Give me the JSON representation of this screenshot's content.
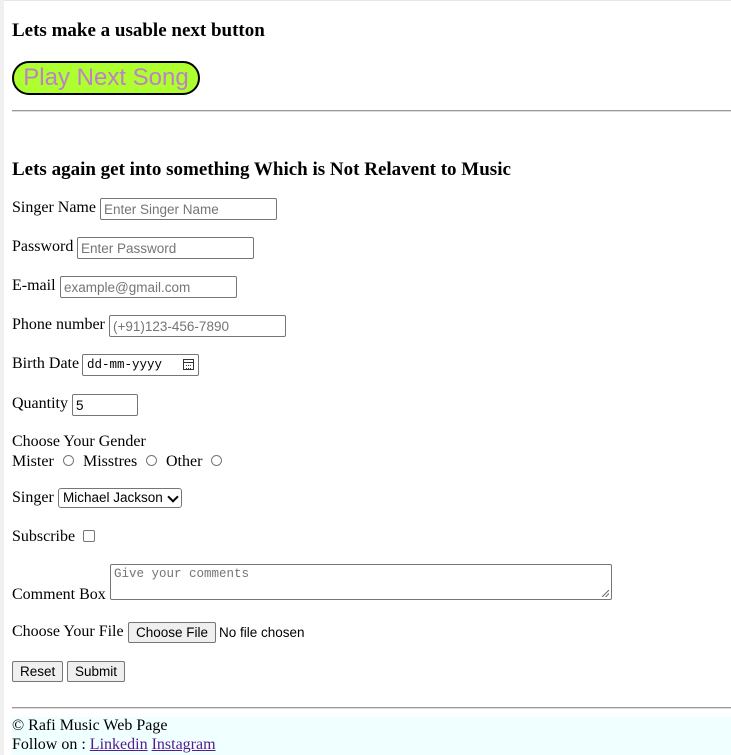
{
  "section1": {
    "heading": "Lets make a usable next button",
    "play_button": "Play Next Song"
  },
  "section2": {
    "heading": "Lets again get into something Which is Not Relavent to Music"
  },
  "form": {
    "singer_name": {
      "label": "Singer Name",
      "placeholder": "Enter Singer Name"
    },
    "password": {
      "label": "Password",
      "placeholder": "Enter Password"
    },
    "email": {
      "label": "E-mail",
      "placeholder": "example@gmail.com"
    },
    "phone": {
      "label": "Phone number",
      "placeholder": "(+91)123-456-7890"
    },
    "birth_date": {
      "label": "Birth Date",
      "placeholder": "dd-mm-yyyy"
    },
    "quantity": {
      "label": "Quantity",
      "value": "5"
    },
    "gender": {
      "label": "Choose Your Gender",
      "options": [
        "Mister",
        "Misstres",
        "Other"
      ]
    },
    "singer": {
      "label": "Singer",
      "selected": "Michael Jackson"
    },
    "subscribe": {
      "label": "Subscribe"
    },
    "comment": {
      "label": "Comment Box",
      "placeholder": "Give your comments"
    },
    "file": {
      "label": "Choose Your File",
      "button": "Choose File",
      "status": "No file chosen"
    },
    "reset": "Reset",
    "submit": "Submit"
  },
  "footer": {
    "copyright": "© Rafi Music Web Page",
    "follow_label": "Follow on : ",
    "links": [
      "Linkedin",
      "Instagram"
    ]
  },
  "colors": {
    "play_button_bg": "#adff2f",
    "play_button_text": "#c080c8",
    "footer_bg": "#f0ffff",
    "visited_link": "#551a8b"
  }
}
